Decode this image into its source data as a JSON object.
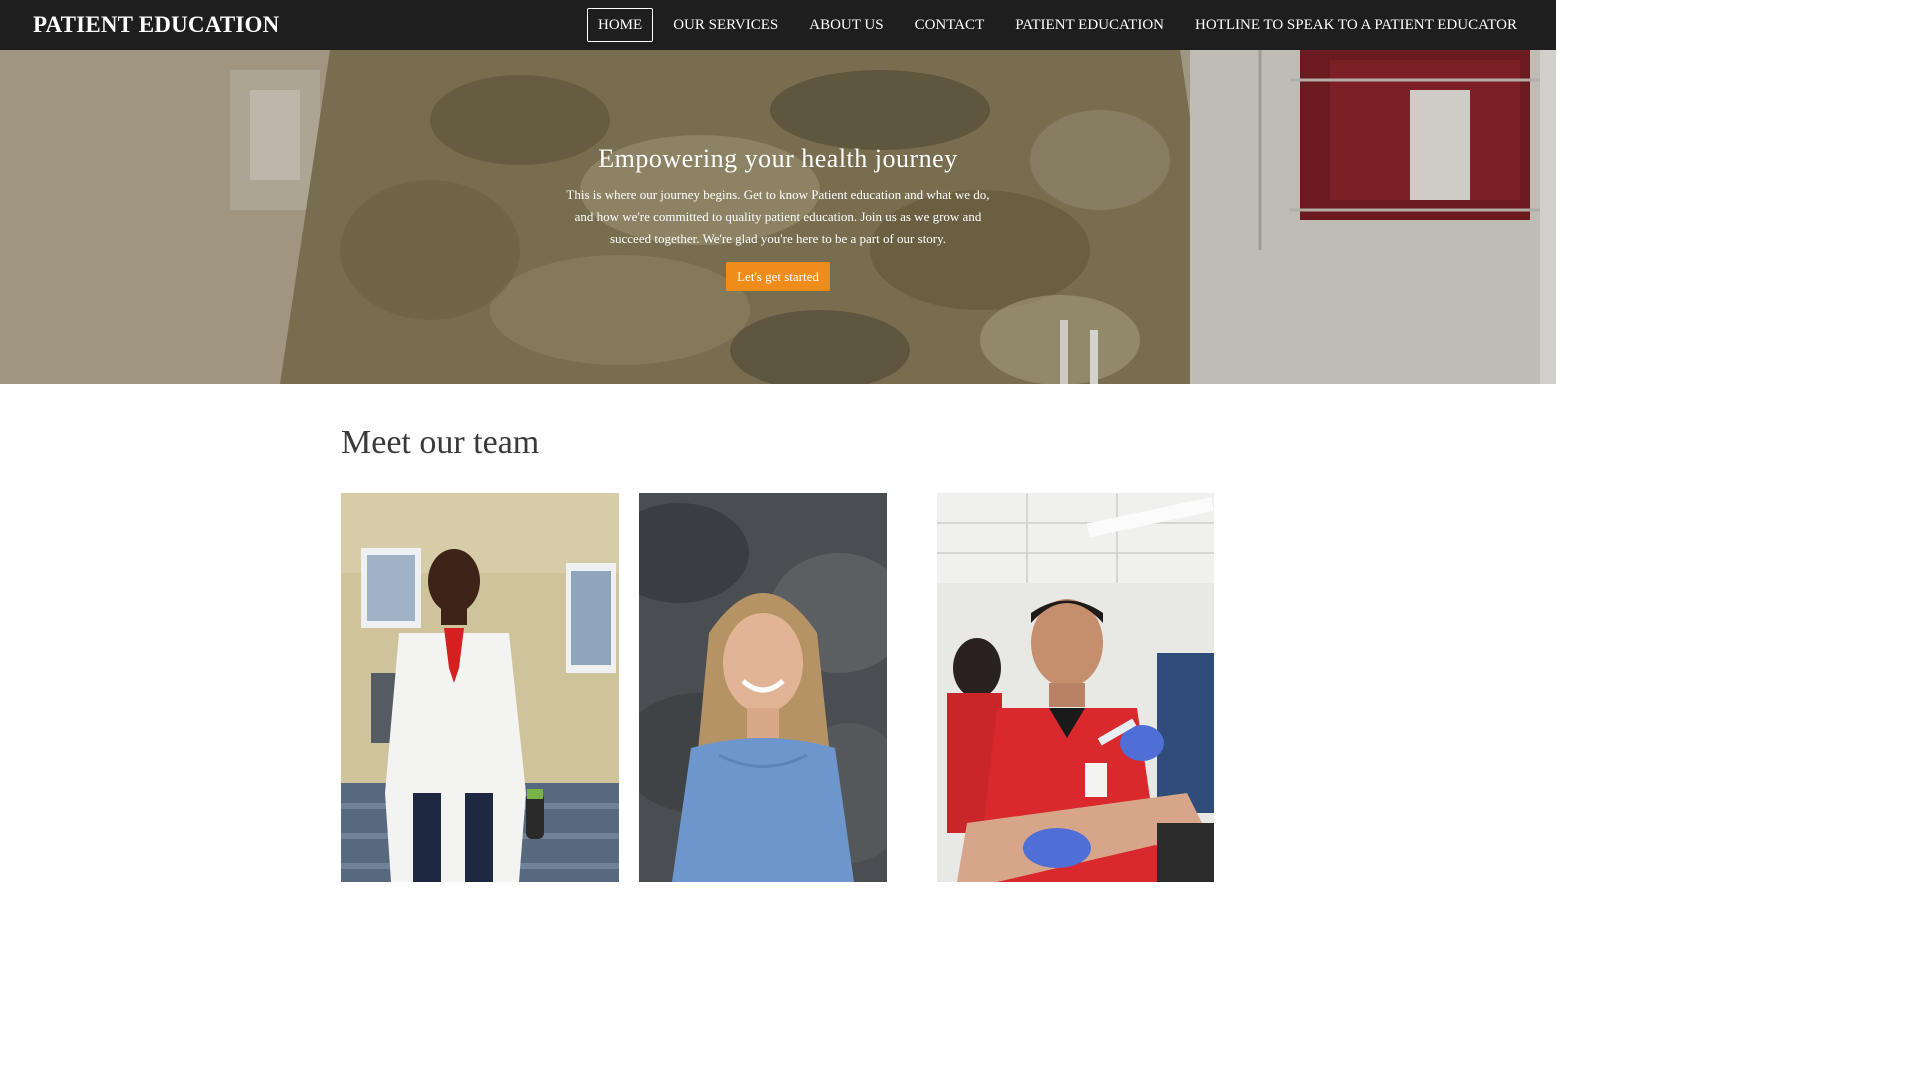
{
  "navbar": {
    "brand": "PATIENT EDUCATION",
    "items": [
      {
        "label": "HOME",
        "active": true
      },
      {
        "label": "OUR SERVICES",
        "active": false
      },
      {
        "label": "ABOUT US",
        "active": false
      },
      {
        "label": "CONTACT",
        "active": false
      },
      {
        "label": "PATIENT EDUCATION",
        "active": false
      },
      {
        "label": "HOTLINE TO SPEAK TO A PATIENT EDUCATOR",
        "active": false
      }
    ]
  },
  "hero": {
    "title": "Empowering your health journey",
    "text": "This is where our journey begins. Get to know Patient education and what we do, and how we're committed to quality patient education. Join us as we grow and succeed together. We're glad you're here to be a part of our story.",
    "button_label": "Let's get started"
  },
  "team": {
    "title": "Meet our team",
    "members": [
      {
        "photo": "team-member-white-coat-photo"
      },
      {
        "photo": "team-member-blue-dress-photo"
      },
      {
        "photo": "team-member-red-scrubs-photo"
      }
    ]
  },
  "colors": {
    "navbar_bg": "#1e1e1e",
    "accent": "#f08c1b",
    "text_dark": "#3a3a3a"
  }
}
